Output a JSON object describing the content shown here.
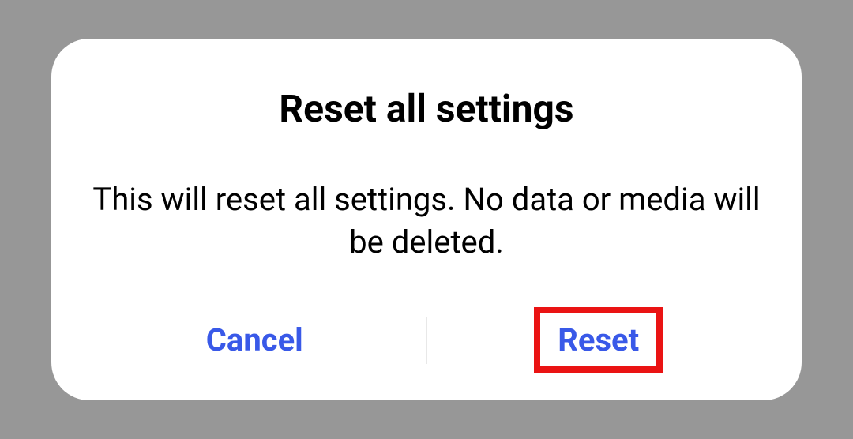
{
  "dialog": {
    "title": "Reset all settings",
    "message": "This will reset all settings. No data or media will be deleted.",
    "cancel_label": "Cancel",
    "confirm_label": "Reset"
  }
}
